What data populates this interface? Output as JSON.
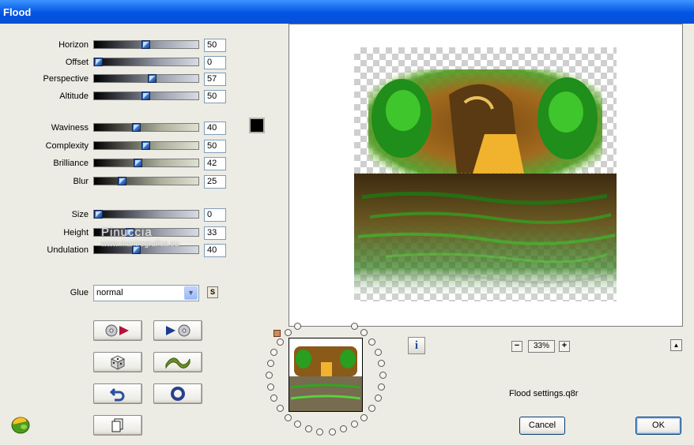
{
  "window": {
    "title": "Flood"
  },
  "sliders_group1": [
    {
      "label": "Horizon",
      "value": "50",
      "level": 50
    },
    {
      "label": "Offset",
      "value": "0",
      "level": 0
    },
    {
      "label": "Perspective",
      "value": "57",
      "level": 57
    },
    {
      "label": "Altitude",
      "value": "50",
      "level": 50
    }
  ],
  "sliders_group2": [
    {
      "label": "Waviness",
      "value": "40",
      "level": 40
    },
    {
      "label": "Complexity",
      "value": "50",
      "level": 50
    },
    {
      "label": "Brilliance",
      "value": "42",
      "level": 42
    },
    {
      "label": "Blur",
      "value": "25",
      "level": 25
    }
  ],
  "sliders_group3": [
    {
      "label": "Size",
      "value": "0",
      "level": 0
    },
    {
      "label": "Height",
      "value": "33",
      "level": 33
    },
    {
      "label": "Undulation",
      "value": "40",
      "level": 40
    }
  ],
  "color_swatch": "#000000",
  "glue": {
    "label": "Glue",
    "value": "normal",
    "s_button": "S"
  },
  "watermark": {
    "name": "Pinuccia",
    "url": "www.maniregrafica.eu"
  },
  "toolbar_buttons": [
    {
      "name": "load-preset-icon"
    },
    {
      "name": "save-preset-icon"
    },
    {
      "name": "randomize-dice-icon"
    },
    {
      "name": "wave-icon"
    },
    {
      "name": "undo-arrow-icon"
    },
    {
      "name": "reset-circle-icon"
    },
    {
      "name": "copy-page-icon"
    }
  ],
  "info_button": "i",
  "zoom": {
    "minus": "−",
    "value": "33%",
    "plus": "+"
  },
  "scroll_up": "▲",
  "settings_file": "Flood settings.q8r",
  "buttons": {
    "cancel": "Cancel",
    "ok": "OK"
  }
}
